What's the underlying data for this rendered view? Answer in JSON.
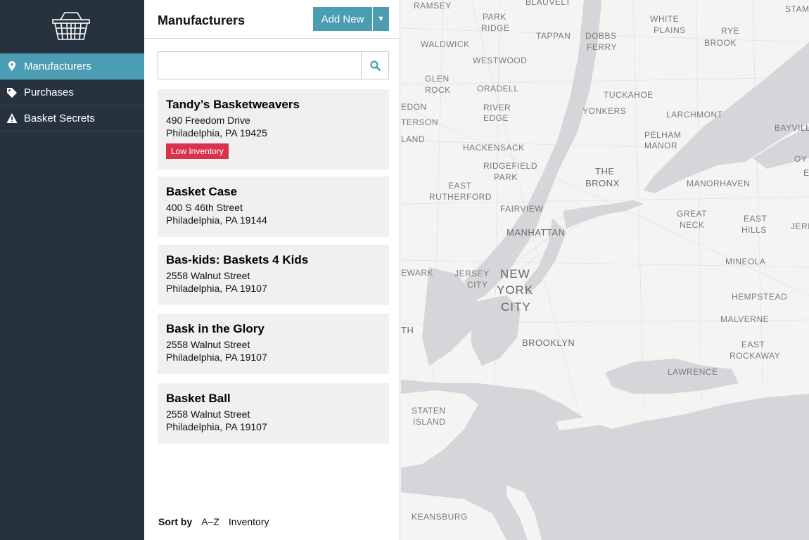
{
  "sidebar": {
    "logo_icon": "basket-icon",
    "items": [
      {
        "label": "Manufacturers",
        "icon": "map-pin-icon",
        "active": true
      },
      {
        "label": "Purchases",
        "icon": "tag-icon",
        "active": false
      },
      {
        "label": "Basket Secrets",
        "icon": "warning-icon",
        "active": false
      }
    ]
  },
  "panel": {
    "title": "Manufacturers",
    "add_label": "Add New",
    "add_caret_icon": "caret-down-icon",
    "search": {
      "value": "",
      "placeholder": "",
      "icon": "search-icon"
    },
    "manufacturers": [
      {
        "name": "Tandy’s Basketweavers",
        "street": "490 Freedom Drive",
        "city": "Philadelphia, PA 19425",
        "badge": "Low Inventory"
      },
      {
        "name": "Basket Case",
        "street": "400 S 46th Street",
        "city": "Philadelphia, PA 19144"
      },
      {
        "name": "Bas-kids: Baskets 4 Kids",
        "street": "2558 Walnut Street",
        "city": "Philadelphia, PA 19107"
      },
      {
        "name": "Bask in the Glory",
        "street": "2558 Walnut Street",
        "city": "Philadelphia, PA 19107"
      },
      {
        "name": "Basket Ball",
        "street": "2558 Walnut Street",
        "city": "Philadelphia, PA 19107"
      }
    ],
    "sort": {
      "label": "Sort by",
      "options": [
        "A–Z",
        "Inventory"
      ]
    }
  },
  "map": {
    "labels": [
      "RAMSEY",
      "BLAUVELT",
      "STAM",
      "PARK",
      "RIDGE",
      "TAPPAN",
      "DOBBS",
      "FERRY",
      "WHITE",
      "PLAINS",
      "RYE",
      "BROOK",
      "WALDWICK",
      "WESTWOOD",
      "GLEN",
      "ROCK",
      "ORADELL",
      "TUCKAHOE",
      "RIVER",
      "EDGE",
      "YONKERS",
      "LARCHMONT",
      "EDON",
      "TERSON",
      "LAND",
      "PELHAM",
      "MANOR",
      "BAYVILL",
      "HACKENSACK",
      "RIDGEFIELD",
      "PARK",
      "OY",
      "E",
      "EAST",
      "RUTHERFORD",
      "THE",
      "BRONX",
      "MANORHAVEN",
      "FAIRVIEW",
      "GREAT",
      "NECK",
      "EAST",
      "HILLS",
      "JERIC",
      "MANHATTAN",
      "MINEOLA",
      "EWARK",
      "JERSEY",
      "CITY",
      "NEW",
      "YORK",
      "CITY",
      "HEMPSTEAD",
      "TH",
      "MALVERNE",
      "BROOKLYN",
      "EAST",
      "ROCKAWAY",
      "LAWRENCE",
      "STATEN",
      "ISLAND",
      "KEANSBURG"
    ],
    "water_color": "#d4d6d9",
    "land_color": "#f4f4f2"
  }
}
